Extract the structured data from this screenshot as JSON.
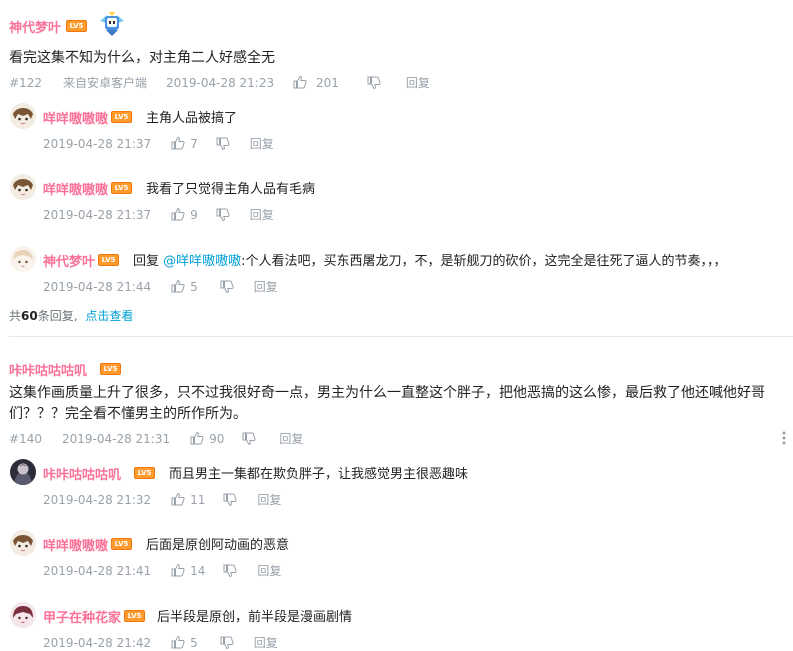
{
  "thread1": {
    "username": "神代梦叶",
    "level": "LV5",
    "content": "看完这集不知为什么，对主角二人好感全无",
    "floor": "#122",
    "client": "来自安卓客户端",
    "time": "2019-04-28 21:23",
    "likes": "201",
    "reply_label": "回复",
    "replies": [
      {
        "username": "咩咩嗷嗷嗷",
        "level": "LV5",
        "text": "主角人品被搞了",
        "time": "2019-04-28 21:37",
        "likes": "7",
        "reply_label": "回复"
      },
      {
        "username": "咩咩嗷嗷嗷",
        "level": "LV5",
        "text": "我看了只觉得主角人品有毛病",
        "time": "2019-04-28 21:37",
        "likes": "9",
        "reply_label": "回复"
      },
      {
        "username": "神代梦叶",
        "level": "LV5",
        "reply_prefix": "回复 ",
        "mention": "@咩咩嗷嗷嗷",
        "text": ":个人看法吧，买东西屠龙刀，不，是斩舰刀的砍价，这完全是往死了逼人的节奏，，，",
        "time": "2019-04-28 21:44",
        "likes": "5",
        "reply_label": "回复"
      }
    ],
    "more": {
      "prefix": "共",
      "count": "60",
      "suffix": "条回复,",
      "link": "点击查看"
    }
  },
  "thread2": {
    "username": "咔咔咕咕咕叽",
    "level": "LV5",
    "content": "这集作画质量上升了很多，只不过我很好奇一点，男主为什么一直整这个胖子，把他恶搞的这么惨，最后救了他还喊他好哥们？？？完全看不懂男主的所作所为。",
    "floor": "#140",
    "time": "2019-04-28 21:31",
    "likes": "90",
    "reply_label": "回复",
    "replies": [
      {
        "username": "咔咔咕咕咕叽",
        "level": "LV5",
        "text": "而且男主一集都在欺负胖子，让我感觉男主很恶趣味",
        "time": "2019-04-28 21:32",
        "likes": "11",
        "reply_label": "回复"
      },
      {
        "username": "咩咩嗷嗷嗷",
        "level": "LV5",
        "text": "后面是原创阿动画的恶意",
        "time": "2019-04-28 21:41",
        "likes": "14",
        "reply_label": "回复"
      },
      {
        "username": "甲子在种花家",
        "level": "LV5",
        "text": "后半段是原创，前半段是漫画剧情",
        "time": "2019-04-28 21:42",
        "likes": "5",
        "reply_label": "回复"
      }
    ]
  },
  "colors": {
    "username": "#fb7299",
    "meta": "#99a2aa",
    "link": "#00a1d6",
    "level_badge": "#ff9b2d"
  },
  "icons": [
    "thumb-up-icon",
    "thumb-down-icon",
    "more-vertical-icon",
    "pendant-badge-icon"
  ]
}
